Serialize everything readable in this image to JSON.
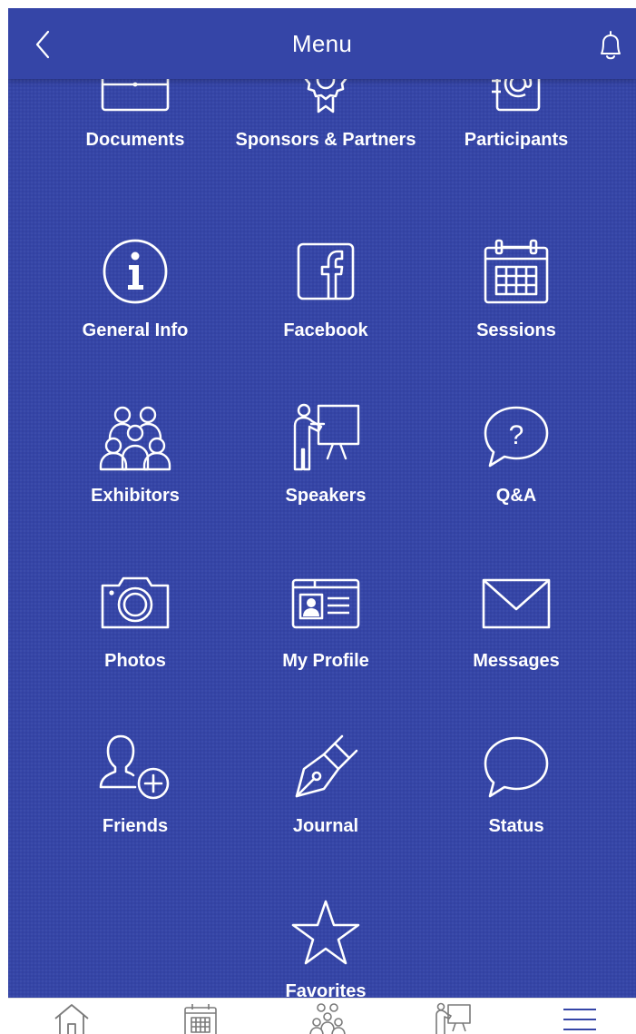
{
  "header": {
    "title": "Menu",
    "back_icon": "chevron-left-icon",
    "notification_icon": "bell-icon"
  },
  "colors": {
    "background": "#3545a7",
    "text": "#ffffff",
    "tabbar_background": "#ffffff",
    "tabbar_icon": "#7a7a7a",
    "tabbar_active": "#3545a7"
  },
  "menu": {
    "items": [
      {
        "label": "Documents",
        "icon": "briefcase-icon"
      },
      {
        "label": "Sponsors & Partners",
        "icon": "award-ribbon-icon"
      },
      {
        "label": "Participants",
        "icon": "address-book-icon"
      },
      {
        "label": "General Info",
        "icon": "info-icon"
      },
      {
        "label": "Facebook",
        "icon": "facebook-icon"
      },
      {
        "label": "Sessions",
        "icon": "calendar-icon"
      },
      {
        "label": "Exhibitors",
        "icon": "people-group-icon"
      },
      {
        "label": "Speakers",
        "icon": "presenter-icon"
      },
      {
        "label": "Q&A",
        "icon": "question-bubble-icon"
      },
      {
        "label": "Photos",
        "icon": "camera-icon"
      },
      {
        "label": "My Profile",
        "icon": "id-card-icon"
      },
      {
        "label": "Messages",
        "icon": "envelope-icon"
      },
      {
        "label": "Friends",
        "icon": "add-friend-icon"
      },
      {
        "label": "Journal",
        "icon": "fountain-pen-icon"
      },
      {
        "label": "Status",
        "icon": "speech-bubble-icon"
      },
      {
        "label": "Favorites",
        "icon": "star-icon"
      }
    ]
  },
  "tabbar": {
    "items": [
      {
        "icon": "home-icon"
      },
      {
        "icon": "calendar-icon"
      },
      {
        "icon": "people-group-icon"
      },
      {
        "icon": "presenter-icon"
      },
      {
        "icon": "hamburger-menu-icon",
        "active": true
      }
    ]
  }
}
